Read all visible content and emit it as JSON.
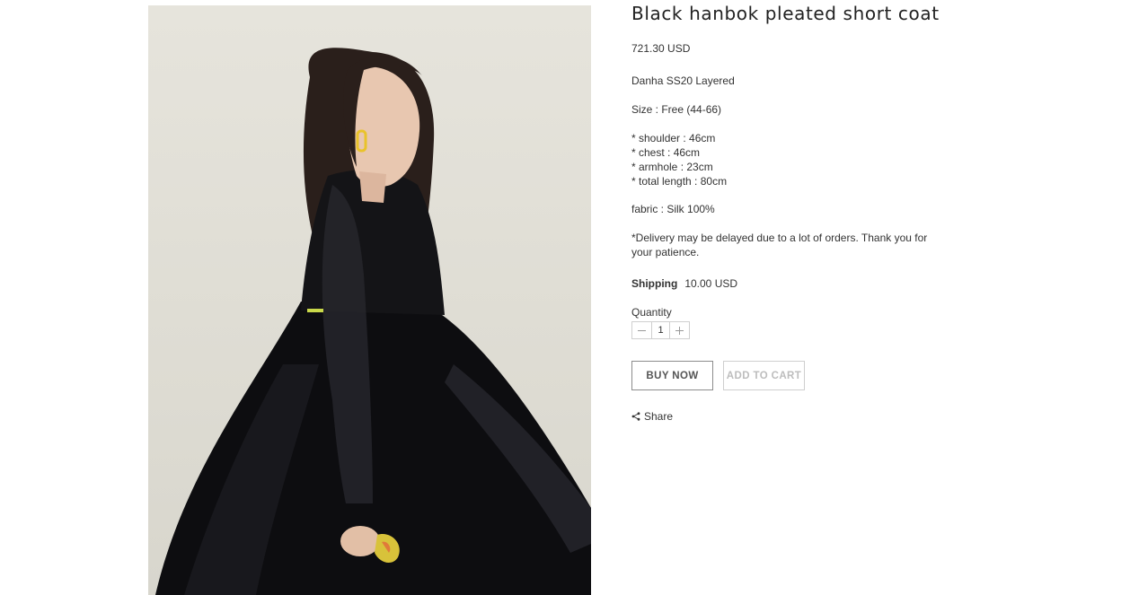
{
  "product": {
    "title": "Black hanbok pleated short coat",
    "price": "721.30 USD",
    "brand": "Danha SS20 Layered",
    "size": "Size : Free (44-66)",
    "measurements": [
      "* shoulder : 46cm",
      "* chest : 46cm",
      "* armhole : 23cm",
      "* total length : 80cm"
    ],
    "fabric": "fabric : Silk 100%",
    "delivery_note": "*Delivery may be delayed due to a lot of orders. Thank you for your patience."
  },
  "shipping": {
    "label": "Shipping",
    "value": "10.00 USD"
  },
  "quantity": {
    "label": "Quantity",
    "value": "1",
    "decrease_icon": "minus-icon",
    "increase_icon": "plus-icon"
  },
  "actions": {
    "buy_now": "BUY NOW",
    "add_to_cart": "ADD TO CART"
  },
  "share": {
    "label": "Share",
    "icon": "share-icon"
  },
  "image": {
    "alt": "model wearing black sheer hanbok coat"
  },
  "colors": {
    "text": "#333333",
    "title": "#222222",
    "button_border": "#8c8c8c",
    "disabled_text": "#bdbdbd",
    "image_background": "#e2e0d8"
  }
}
